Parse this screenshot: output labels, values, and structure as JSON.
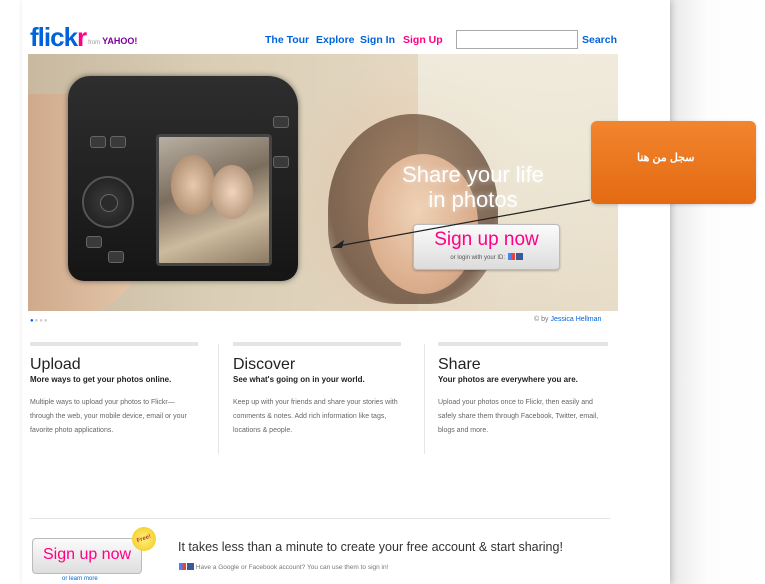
{
  "header": {
    "logo_main": "flick",
    "logo_r": "r",
    "logo_from": "from",
    "logo_yahoo": "YAHOO!",
    "nav": {
      "tour": "The Tour",
      "explore": "Explore",
      "sign_in": "Sign In",
      "sign_up": "Sign Up"
    },
    "search_button": "Search",
    "search_value": ""
  },
  "hero": {
    "tagline_line1": "Share your life",
    "tagline_line2": "in photos",
    "signup_label": "Sign up now",
    "login_text": "or login with your ID:",
    "credit_prefix": "© by",
    "credit_author": "Jessica Hellman"
  },
  "features": [
    {
      "title": "Upload",
      "subtitle": "More ways to get your photos online.",
      "body": "Multiple ways to upload your photos to Flickr—through the web, your mobile device, email or your favorite photo applications."
    },
    {
      "title": "Discover",
      "subtitle": "See what's going on in your world.",
      "body": "Keep up with your friends and share your stories with comments & notes. Add rich information like tags, locations & people."
    },
    {
      "title": "Share",
      "subtitle": "Your photos are everywhere you are.",
      "body": "Upload your photos once to Flickr, then easily and safely share them through Facebook, Twitter, email, blogs and more."
    }
  ],
  "bottom": {
    "signup_label": "Sign up now",
    "free_badge": "Free!",
    "learn_more": "or learn more",
    "headline": "It takes less than a minute to create your free account & start sharing!",
    "subtext": "Have a Google or Facebook account? You can use them to sign in!"
  },
  "annotation": {
    "callout_text": "سجل من هنا",
    "color": "#e8721a"
  },
  "colors": {
    "flickr_blue": "#0063dc",
    "flickr_pink": "#ff0084"
  }
}
